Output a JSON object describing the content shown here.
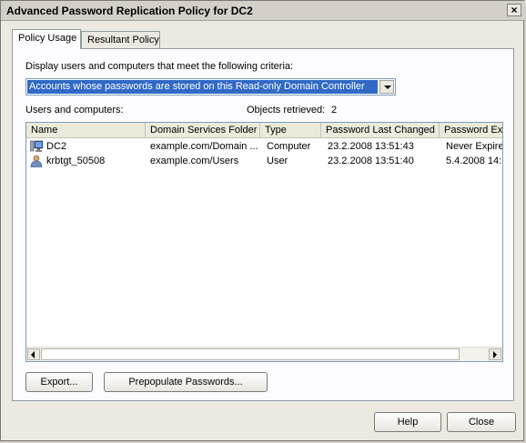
{
  "window": {
    "title": "Advanced Password Replication Policy for DC2",
    "close_glyph": "×"
  },
  "tabs": [
    {
      "label": "Policy Usage",
      "active": true
    },
    {
      "label": "Resultant Policy",
      "active": false
    }
  ],
  "criteria": {
    "label": "Display users and computers that meet the following criteria:",
    "selected": "Accounts whose passwords are stored on this Read-only Domain Controller"
  },
  "list": {
    "label": "Users and computers:",
    "objects_label": "Objects retrieved:",
    "objects_count": "2",
    "columns": [
      "Name",
      "Domain Services Folder",
      "Type",
      "Password Last Changed",
      "Password Ex"
    ],
    "rows": [
      {
        "icon": "computer-icon",
        "name": "DC2",
        "folder": "example.com/Domain ...",
        "type": "Computer",
        "changed": "23.2.2008 13:51:43",
        "expires": "Never Expire"
      },
      {
        "icon": "user-icon",
        "name": "krbtgt_50508",
        "folder": "example.com/Users",
        "type": "User",
        "changed": "23.2.2008 13:51:40",
        "expires": "5.4.2008 14:"
      }
    ]
  },
  "buttons": {
    "export": "Export...",
    "prepopulate": "Prepopulate Passwords...",
    "help": "Help",
    "close": "Close"
  }
}
